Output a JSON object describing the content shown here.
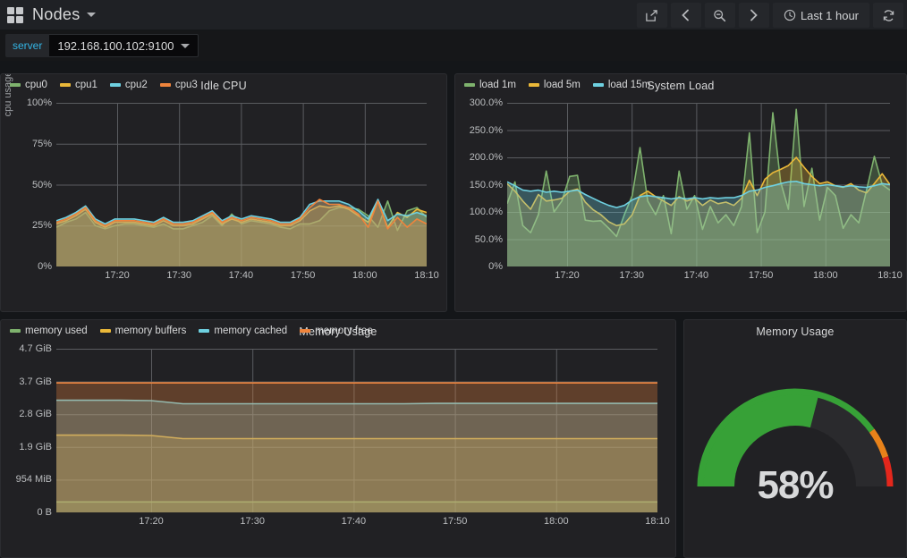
{
  "navbar": {
    "grid_icon": "grid-icon",
    "dashboard_title": "Nodes",
    "share_icon": "share-icon",
    "back_icon": "chevron-left-icon",
    "zoom_out_icon": "zoom-out-icon",
    "forward_icon": "chevron-right-icon",
    "time_range": "Last 1 hour",
    "clock_icon": "clock-icon",
    "refresh_icon": "refresh-icon"
  },
  "submenu": {
    "variable_label": "server",
    "variable_value": "192.168.100.102:9100"
  },
  "colors": {
    "green": "#7eb26d",
    "yellow": "#eab839",
    "blue": "#6ed0e0",
    "orange": "#ef843c",
    "gauge_green": "#37a137",
    "gauge_orange": "#e8821a",
    "gauge_red": "#e4271c",
    "panel_bg": "#212124",
    "accent": "#33b5e5"
  },
  "panels": [
    {
      "id": "idle-cpu",
      "title": "Idle CPU"
    },
    {
      "id": "system-load",
      "title": "System Load"
    },
    {
      "id": "memory-usage-graph",
      "title": "Memory Usage"
    },
    {
      "id": "memory-usage-gauge",
      "title": "Memory Usage",
      "value": "58%"
    }
  ],
  "chart_data": [
    {
      "type": "line",
      "id": "idle-cpu",
      "title": "Idle CPU",
      "xlabel": "",
      "ylabel": "cpu usage",
      "yticks": [
        "0%",
        "25%",
        "50%",
        "75%",
        "100%"
      ],
      "ylim": [
        0,
        100
      ],
      "xticks": [
        "17:20",
        "17:30",
        "17:40",
        "17:50",
        "18:00",
        "18:10"
      ],
      "grid": true,
      "legend_position": "bottom",
      "fill": true,
      "series": [
        {
          "name": "cpu0",
          "color": "#7eb26d",
          "values": [
            24,
            27,
            29,
            33,
            25,
            23,
            25,
            26,
            26,
            25,
            24,
            26,
            23,
            23,
            25,
            27,
            31,
            25,
            32,
            26,
            28,
            27,
            26,
            24,
            23,
            26,
            26,
            28,
            34,
            36,
            36,
            35,
            31,
            24,
            40,
            22,
            34,
            36,
            30
          ]
        },
        {
          "name": "cpu1",
          "color": "#eab839",
          "values": [
            26,
            28,
            31,
            35,
            27,
            24,
            27,
            27,
            27,
            26,
            25,
            28,
            25,
            25,
            26,
            29,
            32,
            26,
            29,
            27,
            29,
            28,
            27,
            25,
            25,
            28,
            34,
            37,
            36,
            37,
            35,
            31,
            27,
            40,
            24,
            33,
            30,
            35,
            33
          ]
        },
        {
          "name": "cpu2",
          "color": "#6ed0e0",
          "values": [
            28,
            30,
            33,
            37,
            29,
            26,
            29,
            29,
            29,
            28,
            27,
            30,
            27,
            27,
            28,
            31,
            34,
            28,
            31,
            29,
            31,
            30,
            29,
            27,
            27,
            30,
            38,
            40,
            40,
            40,
            38,
            34,
            29,
            41,
            28,
            32,
            31,
            33,
            31
          ]
        },
        {
          "name": "cpu3",
          "color": "#ef843c",
          "values": [
            27,
            29,
            32,
            36,
            28,
            25,
            28,
            28,
            28,
            27,
            26,
            29,
            26,
            26,
            27,
            30,
            33,
            27,
            30,
            28,
            30,
            29,
            28,
            26,
            26,
            29,
            36,
            41,
            38,
            38,
            36,
            32,
            24,
            40,
            23,
            30,
            24,
            29,
            26
          ]
        }
      ]
    },
    {
      "type": "line",
      "id": "system-load",
      "title": "System Load",
      "xlabel": "",
      "ylabel": "",
      "yticks": [
        "0%",
        "50.0%",
        "100.0%",
        "150.0%",
        "200.0%",
        "250.0%",
        "300.0%"
      ],
      "ylim": [
        0,
        300
      ],
      "xticks": [
        "17:20",
        "17:30",
        "17:40",
        "17:50",
        "18:00",
        "18:10"
      ],
      "grid": true,
      "legend_position": "bottom",
      "fill": true,
      "series": [
        {
          "name": "load 1m",
          "color": "#7eb26d",
          "values": [
            115,
            155,
            75,
            62,
            95,
            175,
            100,
            120,
            165,
            167,
            85,
            83,
            84,
            70,
            55,
            95,
            130,
            218,
            120,
            95,
            130,
            60,
            175,
            105,
            130,
            68,
            110,
            80,
            95,
            75,
            110,
            245,
            62,
            100,
            282,
            155,
            105,
            288,
            110,
            180,
            85,
            145,
            130,
            70,
            95,
            80,
            140,
            202,
            150,
            140
          ]
        },
        {
          "name": "load 5m",
          "color": "#eab839",
          "values": [
            152,
            138,
            120,
            105,
            132,
            120,
            122,
            125,
            138,
            142,
            118,
            104,
            95,
            82,
            75,
            78,
            95,
            130,
            138,
            128,
            120,
            112,
            128,
            120,
            125,
            112,
            122,
            115,
            118,
            112,
            125,
            158,
            130,
            160,
            172,
            178,
            185,
            200,
            182,
            165,
            152,
            155,
            148,
            145,
            152,
            140,
            135,
            152,
            170,
            150
          ]
        },
        {
          "name": "load 15m",
          "color": "#6ed0e0",
          "values": [
            155,
            148,
            140,
            138,
            140,
            136,
            138,
            136,
            138,
            140,
            132,
            125,
            118,
            112,
            108,
            112,
            122,
            128,
            130,
            128,
            126,
            124,
            126,
            124,
            126,
            124,
            126,
            125,
            126,
            126,
            130,
            138,
            140,
            145,
            148,
            152,
            155,
            156,
            152,
            150,
            148,
            150,
            148,
            146,
            148,
            146,
            145,
            148,
            152,
            150
          ]
        }
      ]
    },
    {
      "type": "line",
      "id": "memory-usage-graph",
      "title": "Memory Usage",
      "xlabel": "",
      "ylabel": "",
      "yticks": [
        "0 B",
        "954 MiB",
        "1.9 GiB",
        "2.8 GiB",
        "3.7 GiB",
        "4.7 GiB"
      ],
      "ylim": [
        0,
        5046586572
      ],
      "xticks": [
        "17:20",
        "17:30",
        "17:40",
        "17:50",
        "18:00",
        "18:10"
      ],
      "grid": true,
      "legend_position": "bottom",
      "fill": true,
      "series": [
        {
          "name": "memory used",
          "color": "#7eb26d",
          "unit": "GiB",
          "values": [
            0.3,
            0.3,
            0.3,
            0.3,
            0.3,
            0.3,
            0.3,
            0.3,
            0.3,
            0.3,
            0.3,
            0.3,
            0.3,
            0.3,
            0.3,
            0.3,
            0.3,
            0.3,
            0.3,
            0.3
          ]
        },
        {
          "name": "memory buffers",
          "color": "#eab839",
          "unit": "GiB",
          "values": [
            2.22,
            2.22,
            2.22,
            2.21,
            2.12,
            2.12,
            2.12,
            2.12,
            2.12,
            2.12,
            2.12,
            2.12,
            2.12,
            2.12,
            2.12,
            2.12,
            2.12,
            2.12,
            2.12,
            2.12
          ]
        },
        {
          "name": "memory cached",
          "color": "#6ed0e0",
          "unit": "GiB",
          "values": [
            3.22,
            3.22,
            3.22,
            3.21,
            3.12,
            3.12,
            3.12,
            3.12,
            3.12,
            3.12,
            3.12,
            3.12,
            3.13,
            3.13,
            3.13,
            3.13,
            3.13,
            3.13,
            3.13,
            3.13
          ]
        },
        {
          "name": "memory free",
          "color": "#ef843c",
          "unit": "GiB",
          "values": [
            3.72,
            3.72,
            3.72,
            3.72,
            3.72,
            3.72,
            3.72,
            3.72,
            3.72,
            3.72,
            3.72,
            3.72,
            3.72,
            3.72,
            3.72,
            3.72,
            3.72,
            3.72,
            3.72,
            3.72
          ]
        }
      ]
    },
    {
      "type": "gauge",
      "id": "memory-usage-gauge",
      "title": "Memory Usage",
      "value": 58,
      "value_label": "58%",
      "min": 0,
      "max": 100,
      "thresholds": [
        {
          "from": 0,
          "to": 80,
          "color": "#37a137"
        },
        {
          "from": 80,
          "to": 90,
          "color": "#e8821a"
        },
        {
          "from": 90,
          "to": 100,
          "color": "#e4271c"
        }
      ]
    }
  ]
}
